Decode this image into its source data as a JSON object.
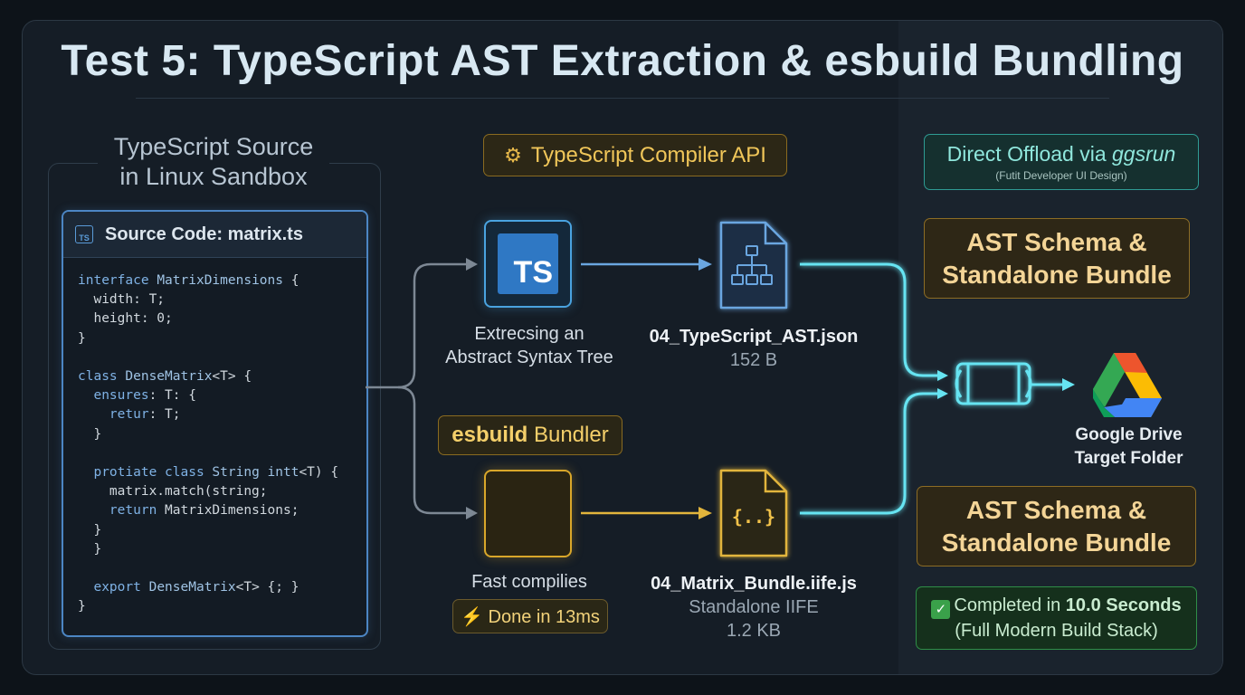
{
  "title": "Test 5: TypeScript AST Extraction & esbuild Bundling",
  "source_panel": {
    "heading_line1": "TypeScript Source",
    "heading_line2": "in Linux Sandbox",
    "card_icon": "TS",
    "card_title": "Source Code: matrix.ts"
  },
  "compiler": {
    "label": "TypeScript Compiler API",
    "icon_text": "TS",
    "caption_line1": "Extrecsing an",
    "caption_line2": "Abstract Syntax Tree"
  },
  "esbuild": {
    "label_bold": "esbuild",
    "label_rest": "Bundler",
    "caption": "Fast compilies",
    "done_badge": "⚡ Done in 13ms"
  },
  "outputs": {
    "ast_file": "04_TypeScript_AST.json",
    "ast_size": "152 B",
    "bundle_file": "04_Matrix_Bundle.iife.js",
    "bundle_type": "Standalone IIFE",
    "bundle_size": "1.2 KB",
    "bundle_icon": "{..}"
  },
  "right_panel": {
    "offload_title_prefix": "Direct Offload via ",
    "offload_title_italic": "ggsrun",
    "offload_subtitle": "(Futit Developer UI Design)",
    "schema_top_line1": "AST Schema &",
    "schema_top_line2": "Standalone Bundle",
    "schema_bottom_line1": "AST Schema &",
    "schema_bottom_line2": "Standalone Bundle",
    "drive_label_line1": "Google Drive",
    "drive_label_line2": "Target Folder",
    "complete_prefix": "Completed in ",
    "complete_bold": "10.0 Seconds",
    "complete_line2": "(Full Modern Build Stack)"
  },
  "colors": {
    "accent_blue": "#4aa3e0",
    "accent_yellow": "#e8b63a",
    "accent_cyan": "#5fe0f0",
    "accent_green": "#3aa14a"
  },
  "icons": [
    "gear-icon",
    "typescript-icon",
    "esbuild-chevron-icon",
    "json-tree-file-icon",
    "js-file-icon",
    "pipe-connector-icon",
    "google-drive-icon",
    "check-icon",
    "lightning-icon"
  ]
}
